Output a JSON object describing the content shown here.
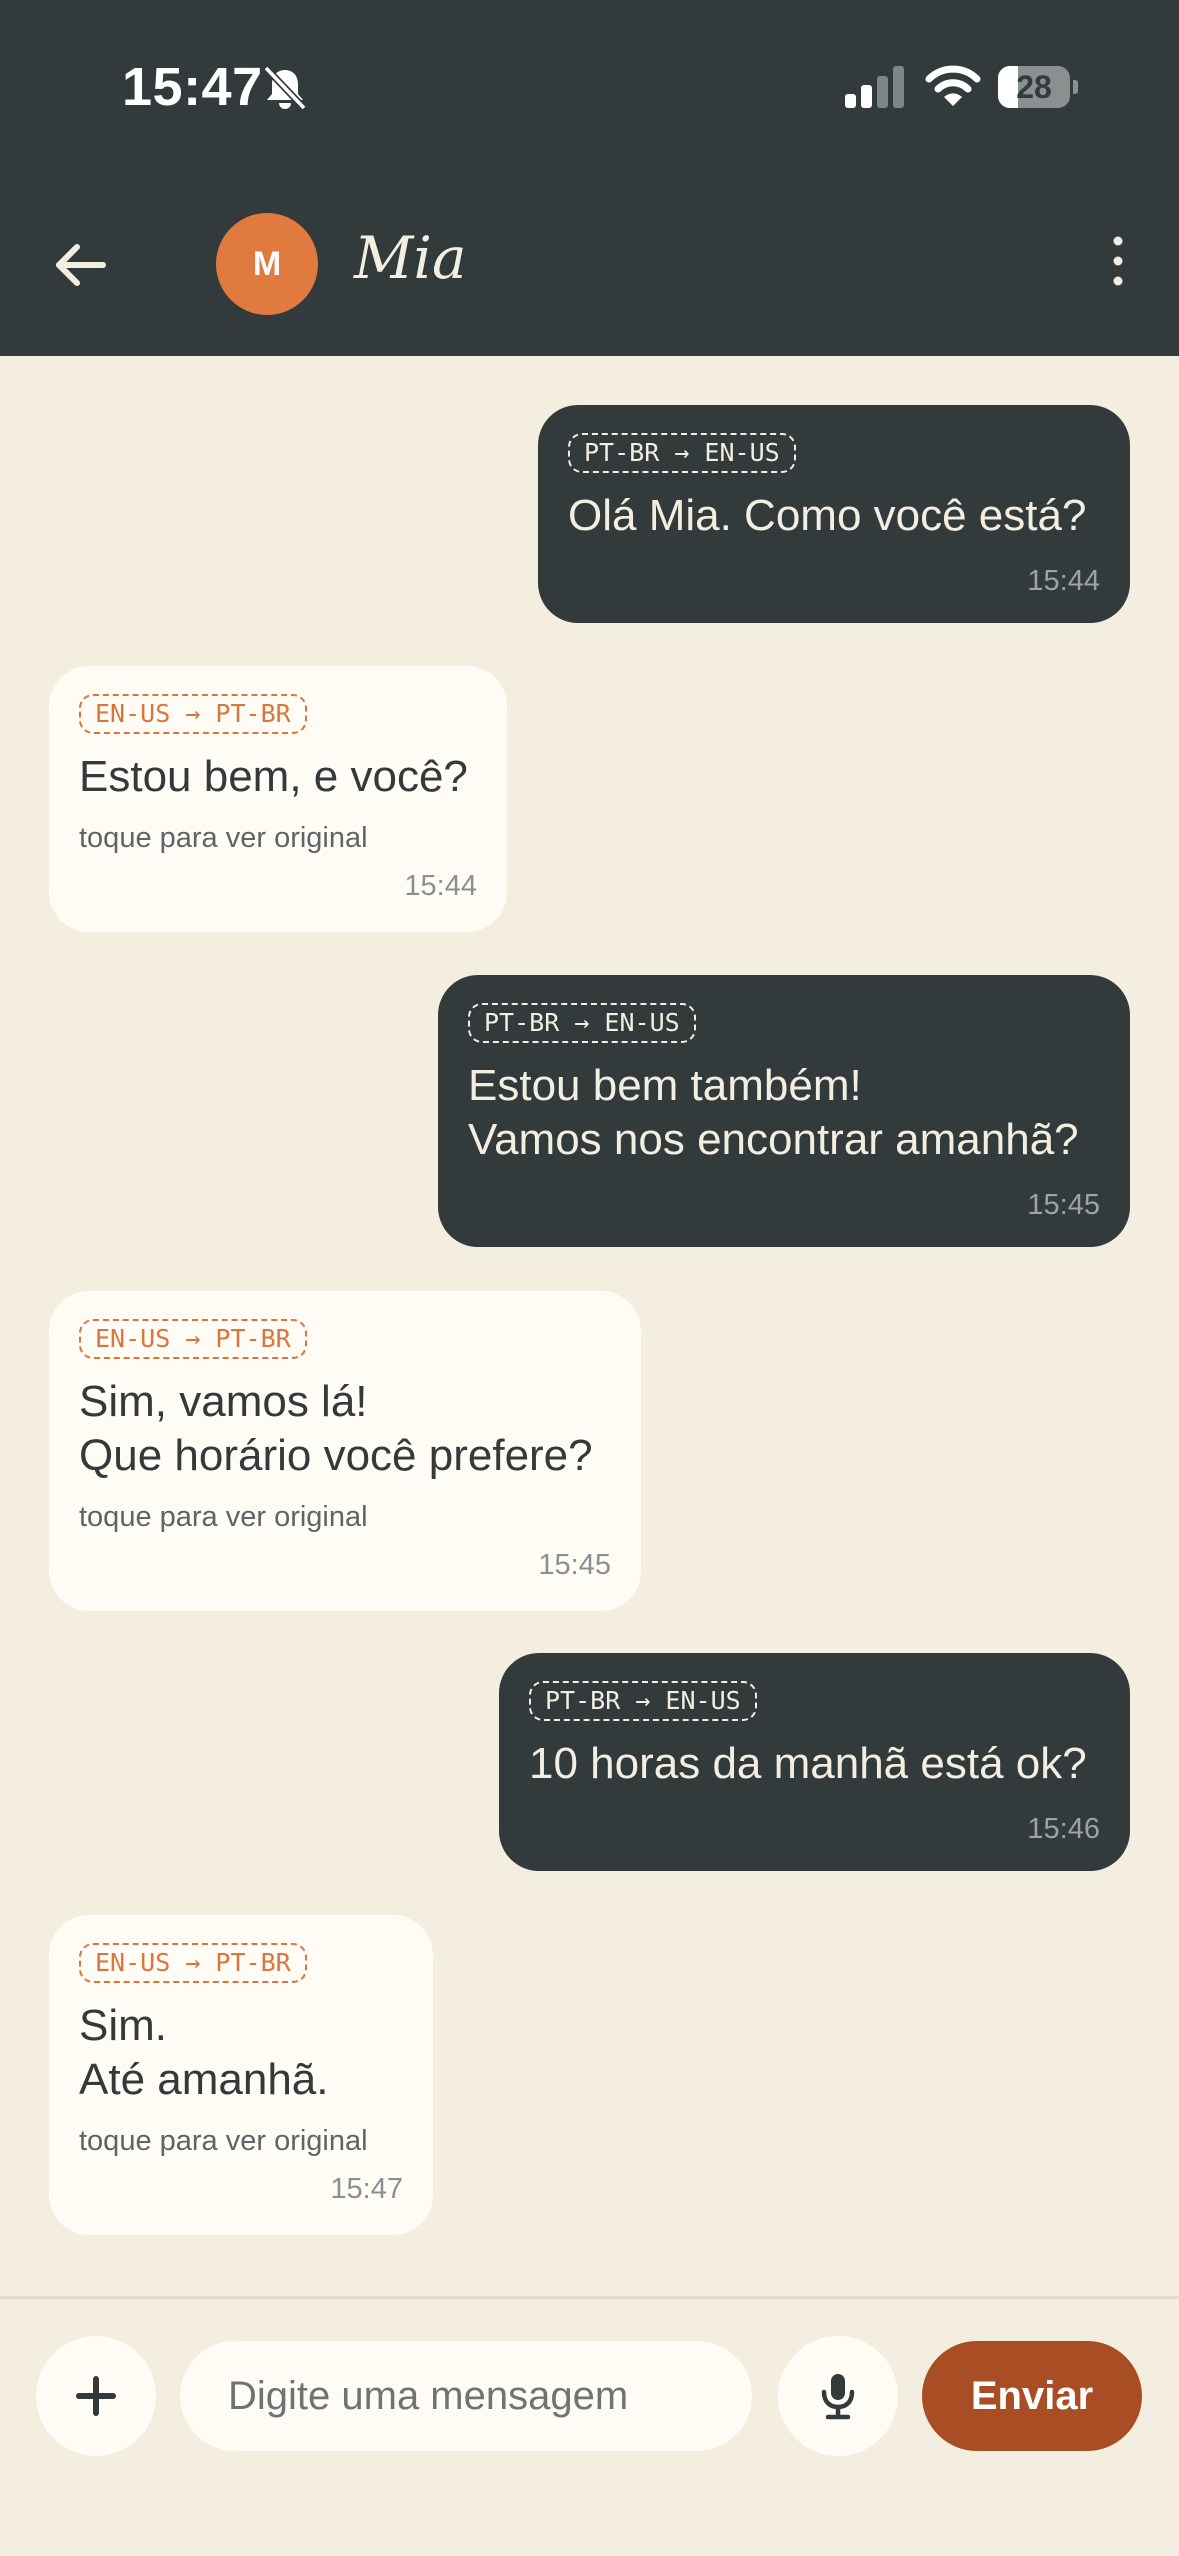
{
  "status_bar": {
    "time": "15:47",
    "battery": "28",
    "battery_level_percent": 28
  },
  "chat_header": {
    "avatar_initial": "M",
    "contact_name": "Mia"
  },
  "messages": [
    {
      "direction": "outgoing",
      "lang": "PT-BR → EN-US",
      "text": "Olá Mia. Como você está?",
      "time": "15:44"
    },
    {
      "direction": "incoming",
      "lang": "EN-US → PT-BR",
      "text": "Estou bem, e você?",
      "hint": "toque para ver original",
      "time": "15:44"
    },
    {
      "direction": "outgoing",
      "lang": "PT-BR → EN-US",
      "text": "Estou bem também!\nVamos nos encontrar amanhã?",
      "time": "15:45"
    },
    {
      "direction": "incoming",
      "lang": "EN-US → PT-BR",
      "text": "Sim, vamos lá!\nQue horário você prefere?",
      "hint": "toque para ver original",
      "time": "15:45"
    },
    {
      "direction": "outgoing",
      "lang": "PT-BR → EN-US",
      "text": "10 horas da manhã está ok?",
      "time": "15:46"
    },
    {
      "direction": "incoming",
      "lang": "EN-US → PT-BR",
      "text": "Sim.\nAté amanhã.",
      "hint": "toque para ver original",
      "time": "15:47"
    }
  ],
  "composer": {
    "placeholder": "Digite uma mensagem",
    "value": "",
    "send_label": "Enviar"
  },
  "colors": {
    "header_bg": "#323A3C",
    "chat_bg": "#F4EEE1",
    "incoming_bubble": "#FFFCF5",
    "accent_orange": "#E07A3F",
    "send_button": "#A94E24"
  },
  "icons": {
    "back": "arrow-left-icon",
    "menu": "more-vertical-icon",
    "add": "plus-icon",
    "mic": "microphone-icon",
    "bell": "bell-off-icon",
    "signal": "signal-icon",
    "wifi": "wifi-icon",
    "battery": "battery-icon"
  }
}
